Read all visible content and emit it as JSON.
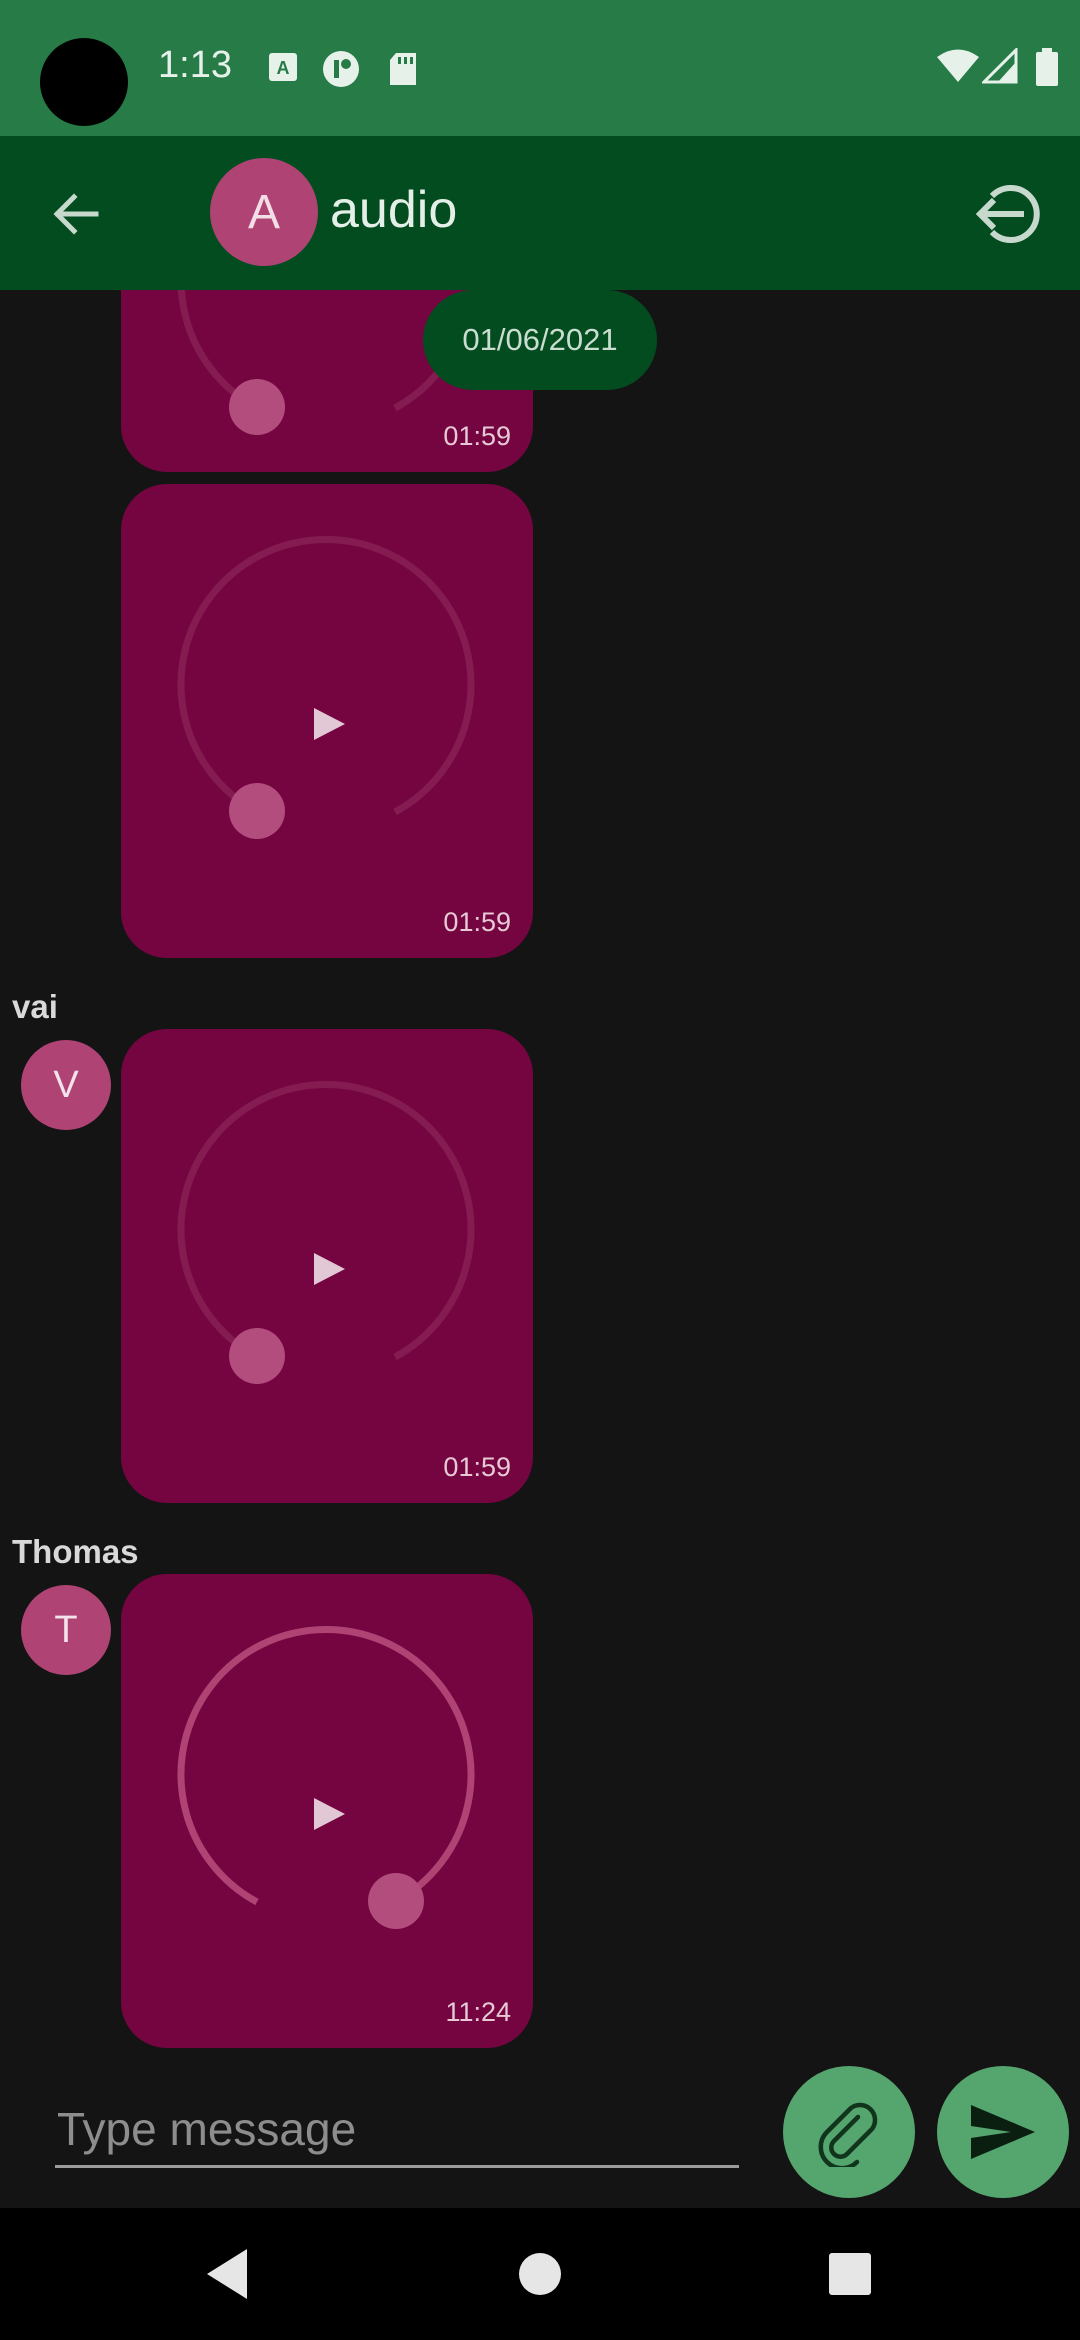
{
  "status_bar": {
    "time": "1:13",
    "left_icons": [
      "app-font-icon",
      "app-circle-icon",
      "sd-card-icon"
    ],
    "right_icons": [
      "wifi-icon",
      "signal-icon",
      "battery-icon"
    ]
  },
  "header": {
    "avatar_letter": "A",
    "title": "audio",
    "back_icon": "arrow-back-icon",
    "logout_icon": "logout-icon"
  },
  "chat": {
    "date_chip": "01/06/2021",
    "messages": [
      {
        "sender": "",
        "avatar": "",
        "duration": "01:59",
        "progress": 0.0
      },
      {
        "sender": "",
        "avatar": "",
        "duration": "01:59",
        "progress": 0.0
      },
      {
        "sender": "vai",
        "avatar": "V",
        "duration": "01:59",
        "progress": 0.0
      },
      {
        "sender": "Thomas",
        "avatar": "T",
        "duration": "11:24",
        "progress": 1.0
      }
    ]
  },
  "composer": {
    "placeholder": "Type message",
    "attach_icon": "paperclip-icon",
    "send_icon": "send-icon"
  },
  "nav": {
    "icons": [
      "nav-back-icon",
      "nav-home-icon",
      "nav-recents-icon"
    ]
  },
  "colors": {
    "status_bar": "#267B47",
    "app_bar": "#024C1F",
    "bubble": "#740540",
    "avatar": "#AE4374",
    "fab": "#55A56E",
    "background": "#141414"
  }
}
